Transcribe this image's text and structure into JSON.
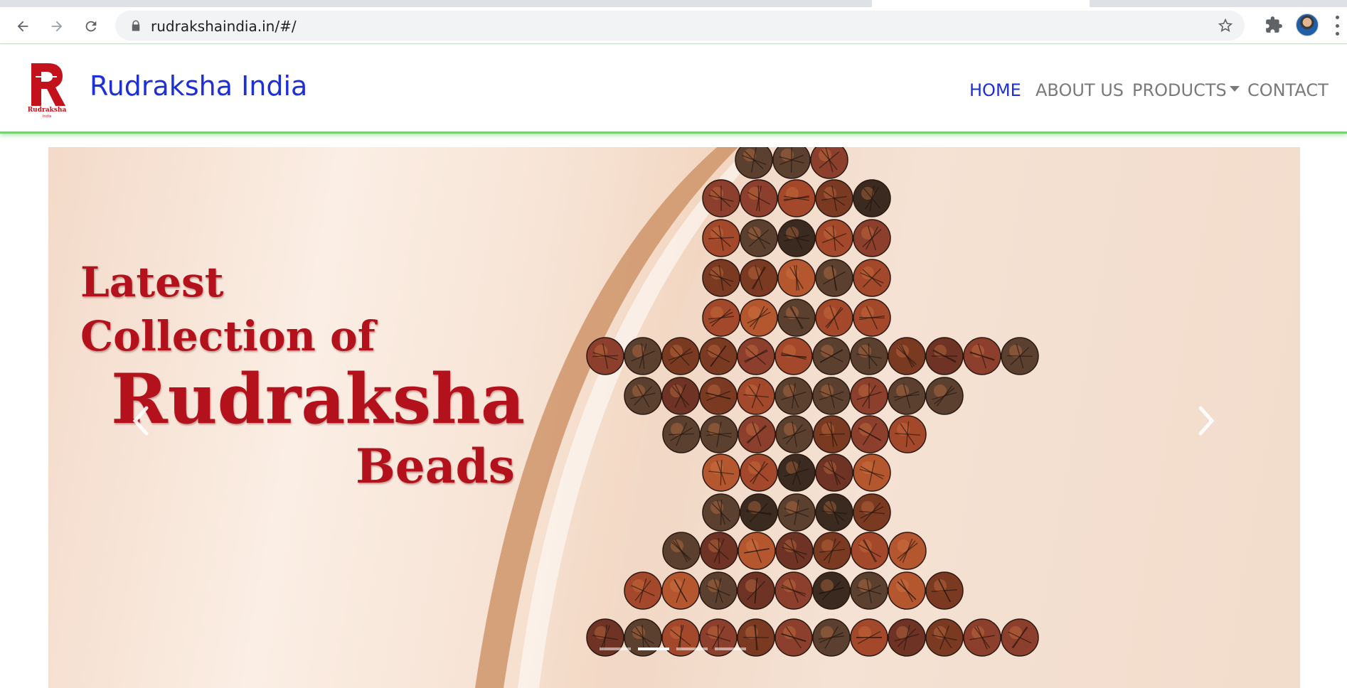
{
  "browser": {
    "url": "rudrakshaindia.in/#/"
  },
  "site": {
    "brand": "Rudraksha India",
    "logo_text": "Rudraksha",
    "logo_subtext": "India",
    "nav": [
      {
        "label": "HOME",
        "active": true
      },
      {
        "label": "ABOUT US",
        "active": false
      },
      {
        "label": "PRODUCTS",
        "active": false,
        "dropdown": true
      },
      {
        "label": "CONTACT",
        "active": false
      }
    ]
  },
  "carousel": {
    "slide_text": {
      "line1": "Latest",
      "line2": "Collection of",
      "line3": "Rudraksha",
      "line4": "Beads"
    },
    "indicator_count": 4,
    "active_indicator": 2
  },
  "colors": {
    "brand_blue": "#1d2fd6",
    "nav_gray": "#7a7a7a",
    "accent_green": "#57e84e",
    "headline_red": "#b3121c"
  },
  "icons": [
    "back-icon",
    "forward-icon",
    "reload-icon",
    "lock-icon",
    "star-icon",
    "extensions-icon",
    "profile-avatar",
    "menu-icon",
    "chevron-left-icon",
    "chevron-right-icon"
  ]
}
